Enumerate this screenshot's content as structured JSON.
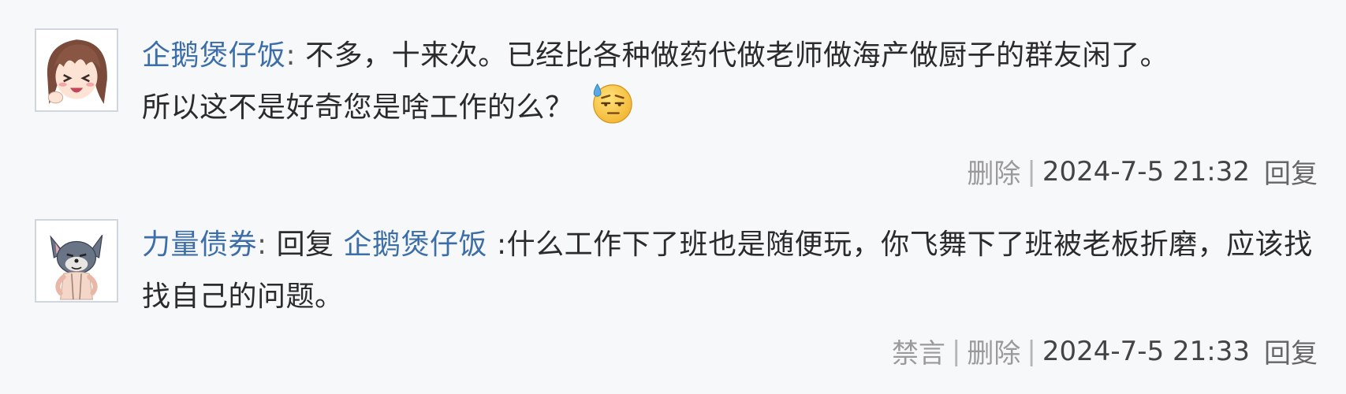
{
  "comments": [
    {
      "username": "企鹅煲仔饭",
      "colon": ":",
      "text_line1": " 不多，十来次。已经比各种做药代做老师做海产做厨子的群友闲了。",
      "text_line2": "所以这不是好奇您是啥工作的么？",
      "emoji_icon": "sweat-smile-emoji",
      "actions": [
        "删除"
      ],
      "timestamp": "2024-7-5 21:32",
      "reply_label": "回复"
    },
    {
      "username": "力量债券",
      "colon": ":",
      "reply_prefix": " 回复 ",
      "reply_to": "企鹅煲仔饭",
      "text": " :什么工作下了班也是随便玩，你飞舞下了班被老板折磨，应该找找自己的问题。",
      "actions": [
        "禁言",
        "删除"
      ],
      "timestamp": "2024-7-5 21:33",
      "reply_label": "回复"
    }
  ],
  "separator": "|",
  "colors": {
    "background": "#f6f8fa",
    "link": "#3d6ea7",
    "muted": "#9a9a9a",
    "text": "#2b2b2b"
  }
}
